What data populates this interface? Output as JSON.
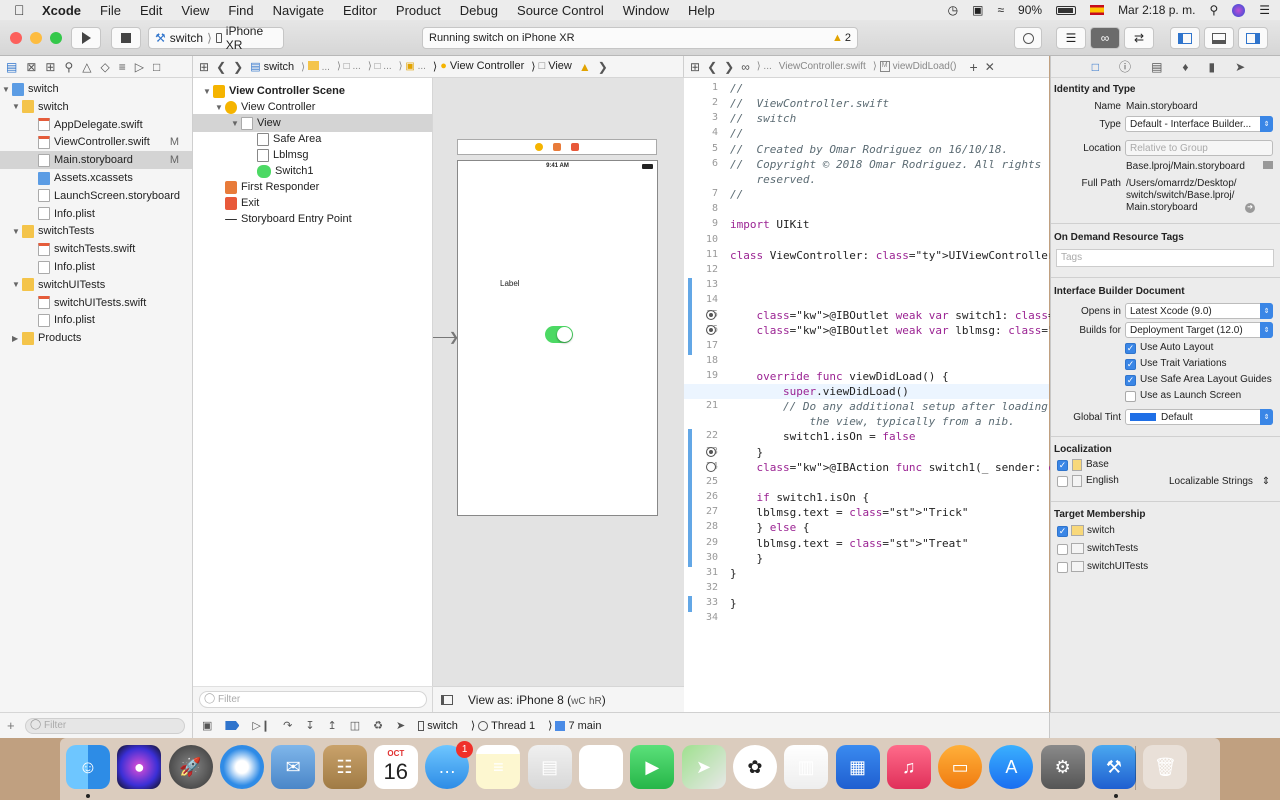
{
  "menubar": {
    "apple": "",
    "app": "Xcode",
    "items": [
      "File",
      "Edit",
      "View",
      "Find",
      "Navigate",
      "Editor",
      "Product",
      "Debug",
      "Source Control",
      "Window",
      "Help"
    ],
    "battery": "90%",
    "clock": "Mar 2:18 p. m."
  },
  "toolbar": {
    "scheme": "switch",
    "device": "iPhone XR",
    "status": "Running switch on iPhone XR",
    "warnings": "2"
  },
  "navigator": {
    "items": [
      {
        "label": "switch",
        "kind": "project",
        "sel": false,
        "badge": ""
      },
      {
        "label": "switch",
        "kind": "folder",
        "sel": false,
        "badge": ""
      },
      {
        "label": "AppDelegate.swift",
        "kind": "swift",
        "sel": false,
        "badge": ""
      },
      {
        "label": "ViewController.swift",
        "kind": "swift",
        "sel": false,
        "badge": "M"
      },
      {
        "label": "Main.storyboard",
        "kind": "doc",
        "sel": true,
        "badge": "M"
      },
      {
        "label": "Assets.xcassets",
        "kind": "asset",
        "sel": false,
        "badge": ""
      },
      {
        "label": "LaunchScreen.storyboard",
        "kind": "doc",
        "sel": false,
        "badge": ""
      },
      {
        "label": "Info.plist",
        "kind": "doc",
        "sel": false,
        "badge": ""
      },
      {
        "label": "switchTests",
        "kind": "folder",
        "sel": false,
        "badge": ""
      },
      {
        "label": "switchTests.swift",
        "kind": "swift",
        "sel": false,
        "badge": ""
      },
      {
        "label": "Info.plist",
        "kind": "doc",
        "sel": false,
        "badge": ""
      },
      {
        "label": "switchUITests",
        "kind": "folder",
        "sel": false,
        "badge": ""
      },
      {
        "label": "switchUITests.swift",
        "kind": "swift",
        "sel": false,
        "badge": ""
      },
      {
        "label": "Info.plist",
        "kind": "doc",
        "sel": false,
        "badge": ""
      },
      {
        "label": "Products",
        "kind": "folder",
        "sel": false,
        "badge": ""
      }
    ],
    "filter_placeholder": "Filter"
  },
  "ib_jumpbar": {
    "controller": "View Controller",
    "view": "View"
  },
  "outline": {
    "items": [
      "View Controller Scene",
      "View Controller",
      "View",
      "Safe Area",
      "Lblmsg",
      "Switch1",
      "First Responder",
      "Exit",
      "Storyboard Entry Point"
    ],
    "filter_placeholder": "Filter"
  },
  "canvas": {
    "time": "9:41 AM",
    "label": "Label",
    "view_as": "View as: iPhone 8 (",
    "view_as_w": "wC",
    "view_as_h": "hR",
    "view_as_end": ")"
  },
  "debugbar": {
    "target": "switch",
    "thread": "Thread 1",
    "frame": "7 main"
  },
  "editor_jumpbar": {
    "file": "ViewController.swift",
    "method": "viewDidLoad()"
  },
  "code": {
    "lines": [
      {
        "n": "1",
        "t": "//"
      },
      {
        "n": "2",
        "t": "//  ViewController.swift"
      },
      {
        "n": "3",
        "t": "//  switch"
      },
      {
        "n": "4",
        "t": "//"
      },
      {
        "n": "5",
        "t": "//  Created by Omar Rodriguez on 16/10/18."
      },
      {
        "n": "6",
        "t": "//  Copyright © 2018 Omar Rodriguez. All rights"
      },
      {
        "n": "",
        "t": "    reserved."
      },
      {
        "n": "7",
        "t": "//"
      },
      {
        "n": "8",
        "t": ""
      },
      {
        "n": "9",
        "t": "import UIKit"
      },
      {
        "n": "10",
        "t": ""
      },
      {
        "n": "11",
        "t": "class ViewController: UIViewController {"
      },
      {
        "n": "12",
        "t": ""
      },
      {
        "n": "13",
        "t": ""
      },
      {
        "n": "14",
        "t": ""
      },
      {
        "n": "15",
        "t": "    @IBOutlet weak var switch1: UISwitch!"
      },
      {
        "n": "16",
        "t": "    @IBOutlet weak var lblmsg: UILabel!"
      },
      {
        "n": "17",
        "t": ""
      },
      {
        "n": "18",
        "t": ""
      },
      {
        "n": "19",
        "t": "    override func viewDidLoad() {"
      },
      {
        "n": "20",
        "t": "        super.viewDidLoad()"
      },
      {
        "n": "21",
        "t": "        // Do any additional setup after loading"
      },
      {
        "n": "",
        "t": "            the view, typically from a nib."
      },
      {
        "n": "22",
        "t": "        switch1.isOn = false"
      },
      {
        "n": "23",
        "t": "    }"
      },
      {
        "n": "24",
        "t": "    @IBAction func switch1(_ sender: UISwitch) {"
      },
      {
        "n": "25",
        "t": ""
      },
      {
        "n": "26",
        "t": "    if switch1.isOn {"
      },
      {
        "n": "27",
        "t": "    lblmsg.text = \"Trick\""
      },
      {
        "n": "28",
        "t": "    } else {"
      },
      {
        "n": "29",
        "t": "    lblmsg.text = \"Treat\""
      },
      {
        "n": "30",
        "t": "    }"
      },
      {
        "n": "31",
        "t": "}"
      },
      {
        "n": "32",
        "t": ""
      },
      {
        "n": "33",
        "t": "}"
      },
      {
        "n": "34",
        "t": ""
      }
    ]
  },
  "inspector": {
    "identity_header": "Identity and Type",
    "name_label": "Name",
    "name_value": "Main.storyboard",
    "type_label": "Type",
    "type_value": "Default - Interface Builder...",
    "location_label": "Location",
    "location_value": "Relative to Group",
    "location_path": "Base.lproj/Main.storyboard",
    "fullpath_label": "Full Path",
    "fullpath_value_1": "/Users/omarrdz/Desktop/",
    "fullpath_value_2": "switch/switch/Base.lproj/",
    "fullpath_value_3": "Main.storyboard",
    "odr_header": "On Demand Resource Tags",
    "tags_placeholder": "Tags",
    "ibdoc_header": "Interface Builder Document",
    "opens_label": "Opens in",
    "opens_value": "Latest Xcode (9.0)",
    "builds_label": "Builds for",
    "builds_value": "Deployment Target (12.0)",
    "checks": [
      {
        "label": "Use Auto Layout",
        "on": true
      },
      {
        "label": "Use Trait Variations",
        "on": true
      },
      {
        "label": "Use Safe Area Layout Guides",
        "on": true
      },
      {
        "label": "Use as Launch Screen",
        "on": false
      }
    ],
    "tint_label": "Global Tint",
    "tint_value": "Default",
    "loc_header": "Localization",
    "loc_items": [
      {
        "label": "Base",
        "on": true
      },
      {
        "label": "English",
        "on": false
      }
    ],
    "loc_strings": "Localizable Strings",
    "tm_header": "Target Membership",
    "tm_items": [
      {
        "label": "switch",
        "on": true
      },
      {
        "label": "switchTests",
        "on": false
      },
      {
        "label": "switchUITests",
        "on": false
      }
    ]
  },
  "dock": {
    "calendar_month": "OCT",
    "calendar_day": "16",
    "messages_badge": "1",
    "apps": [
      "finder-icon",
      "siri-icon",
      "launchpad-icon",
      "safari-icon",
      "mail-icon",
      "contacts-icon",
      "calendar-icon",
      "messages-icon",
      "notes-icon",
      "preview-icon",
      "reminders-icon",
      "facetime-icon",
      "maps-icon",
      "photos-icon",
      "numbers-icon",
      "keynote-icon",
      "music-icon",
      "books-icon",
      "app-store-icon",
      "system-preferences-icon",
      "xcode-icon",
      "trash-icon"
    ]
  }
}
